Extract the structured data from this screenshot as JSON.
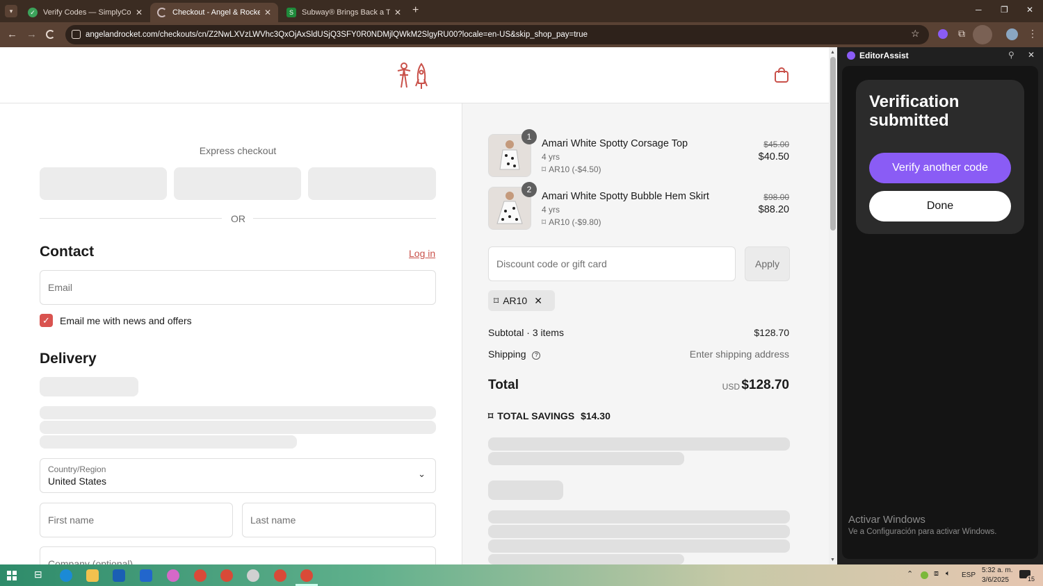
{
  "browser": {
    "tabs": [
      {
        "title": "Verify Codes — SimplyCodes",
        "close": "✕"
      },
      {
        "title": "Checkout - Angel & Rocket",
        "close": "✕"
      },
      {
        "title": "Subway® Brings Back a Tasty O",
        "close": "✕"
      }
    ],
    "new_tab": "+",
    "url": "angelandrocket.com/checkouts/cn/Z2NwLXVzLWVhc3QxOjAxSldUSjQ3SFY0R0NDMjlQWkM2SlgyRU00?locale=en-US&skip_shop_pay=true",
    "window_controls": {
      "minimize": "─",
      "restore": "❐",
      "close": "✕"
    }
  },
  "checkout": {
    "express_checkout": "Express checkout",
    "or": "OR",
    "contact": {
      "heading": "Contact",
      "login": "Log in",
      "email_placeholder": "Email",
      "newsletter_label": "Email me with news and offers",
      "newsletter_checked": true
    },
    "delivery": {
      "heading": "Delivery",
      "country_label": "Country/Region",
      "country_value": "United States",
      "first_name": "First name",
      "last_name": "Last name",
      "company": "Company (optional)"
    }
  },
  "summary": {
    "items": [
      {
        "qty": "1",
        "name": "Amari White Spotty Corsage Top",
        "variant": "4 yrs",
        "discount": "AR10 (-$4.50)",
        "original_price": "$45.00",
        "price": "$40.50"
      },
      {
        "qty": "2",
        "name": "Amari White Spotty Bubble Hem Skirt",
        "variant": "4 yrs",
        "discount": "AR10 (-$9.80)",
        "original_price": "$98.00",
        "price": "$88.20"
      }
    ],
    "discount_placeholder": "Discount code or gift card",
    "apply": "Apply",
    "applied_code": "AR10",
    "subtotal_label": "Subtotal · 3 items",
    "subtotal_value": "$128.70",
    "shipping_label": "Shipping",
    "shipping_value": "Enter shipping address",
    "total_label": "Total",
    "currency": "USD",
    "total_value": "$128.70",
    "savings_label": "TOTAL SAVINGS",
    "savings_value": "$14.30"
  },
  "extension": {
    "title": "EditorAssist",
    "card_title": "Verification submitted",
    "verify_another": "Verify another code",
    "done": "Done",
    "watermark_title": "Activar Windows",
    "watermark_sub": "Ve a Configuración para activar Windows."
  },
  "taskbar": {
    "lang": "ESP",
    "time": "5:32 a. m.",
    "date": "3/6/2025",
    "notif_count": "15"
  },
  "colors": {
    "brand": "#c9514a",
    "checkbox": "#d9534f",
    "extension_accent": "#8a5cf5"
  }
}
